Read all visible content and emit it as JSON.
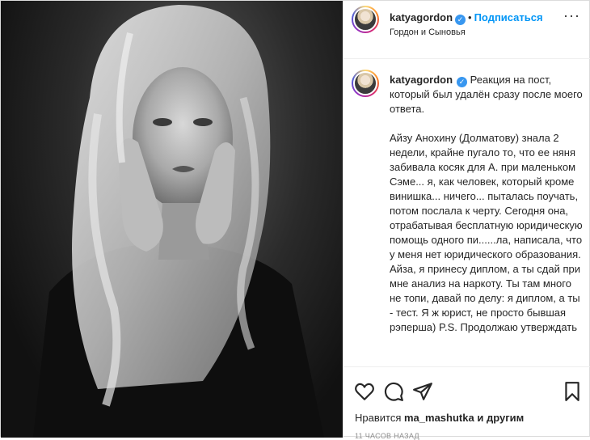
{
  "header": {
    "username": "katyagordon",
    "verified_icon": "verified-badge-icon",
    "separator": "•",
    "follow_label": "Подписаться",
    "location": "Гордон и Сыновья",
    "more_icon": "more-dots-icon",
    "more_label": "···"
  },
  "caption": {
    "username": "katyagordon",
    "paragraphs": [
      "Реакция на пост, который был удалён сразу после моего ответа.",
      "Айзу Анохину (Долматову) знала 2 недели, крайне пугало то, что ее няня забивала косяк для А. при маленьком Сэме... я, как человек, который кроме винишка... ничего... пыталась поучать, потом послала к черту. Сегодня она, отрабатывая бесплатную юридическую помощь одного пи......ла, написала, что у меня нет юридического образования. Айза, я принесу диплом, а ты сдай при мне анализ на наркоту. Ты там много не топи, давай по делу: я диплом, а ты - тест. Я ж юрист, не просто бывшая рэперша) P.S. Продолжаю утверждать"
    ]
  },
  "actions": {
    "like_icon": "heart-icon",
    "comment_icon": "comment-icon",
    "share_icon": "share-icon",
    "save_icon": "bookmark-icon"
  },
  "likes": {
    "prefix": "Нравится",
    "user": "ma_mashutka",
    "suffix": "и другим"
  },
  "timestamp": "11 часов назад",
  "colors": {
    "accent": "#0095f6",
    "verified": "#3897f0",
    "text": "#262626",
    "muted": "#8e8e8e"
  }
}
